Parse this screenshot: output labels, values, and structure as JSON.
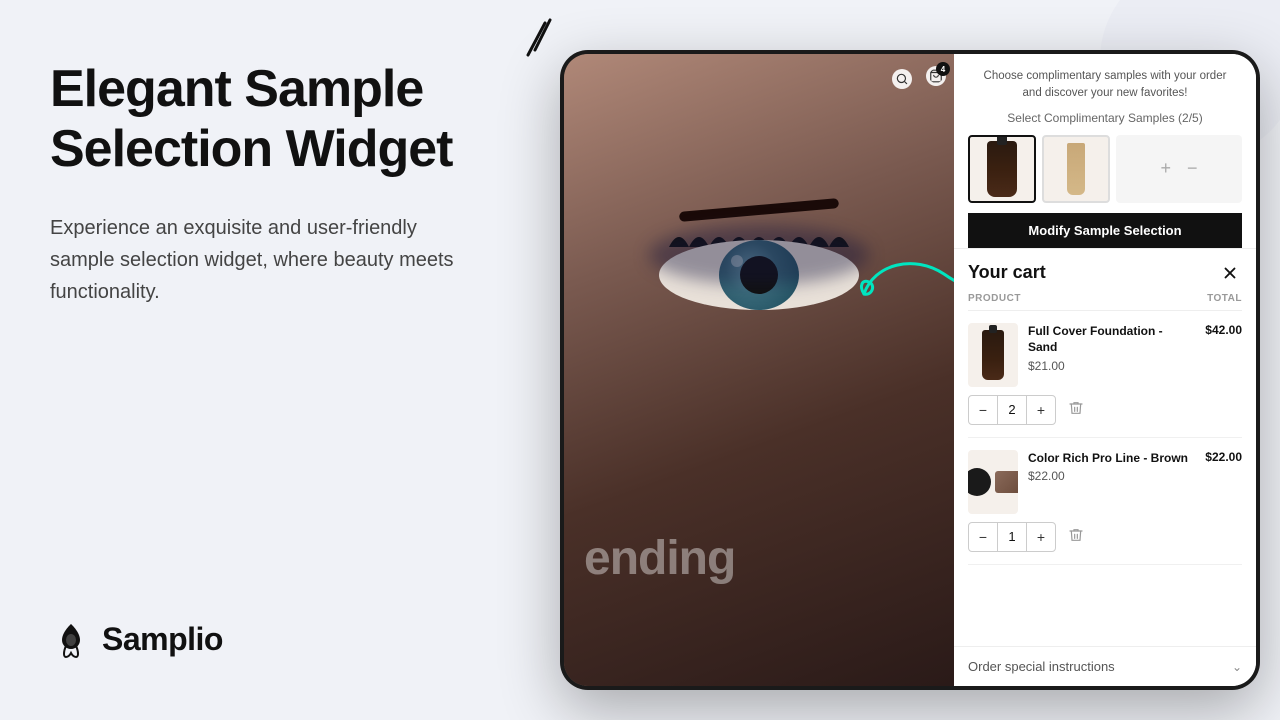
{
  "left": {
    "heading": "Elegant Sample Selection Widget",
    "subtext": "Experience an exquisite and user-friendly sample selection widget, where beauty meets functionality.",
    "logo_text": "Samplio"
  },
  "sample_panel": {
    "intro_line1": "Choose complimentary samples with your order",
    "intro_line2": "and discover your new favorites!",
    "select_label": "Select Complimentary Samples (2/5)",
    "modify_btn": "Modify Sample Selection",
    "plus_icon": "+",
    "minus_icon": "−"
  },
  "cart": {
    "title": "Your cart",
    "col_product": "PRODUCT",
    "col_total": "TOTAL",
    "items": [
      {
        "name": "Full Cover Foundation - Sand",
        "unit_price": "$21.00",
        "total": "$42.00",
        "qty": 2
      },
      {
        "name": "Color Rich Pro Line - Brown",
        "unit_price": "$22.00",
        "total": "$22.00",
        "qty": 1
      }
    ],
    "instructions_label": "Order special instructions"
  }
}
